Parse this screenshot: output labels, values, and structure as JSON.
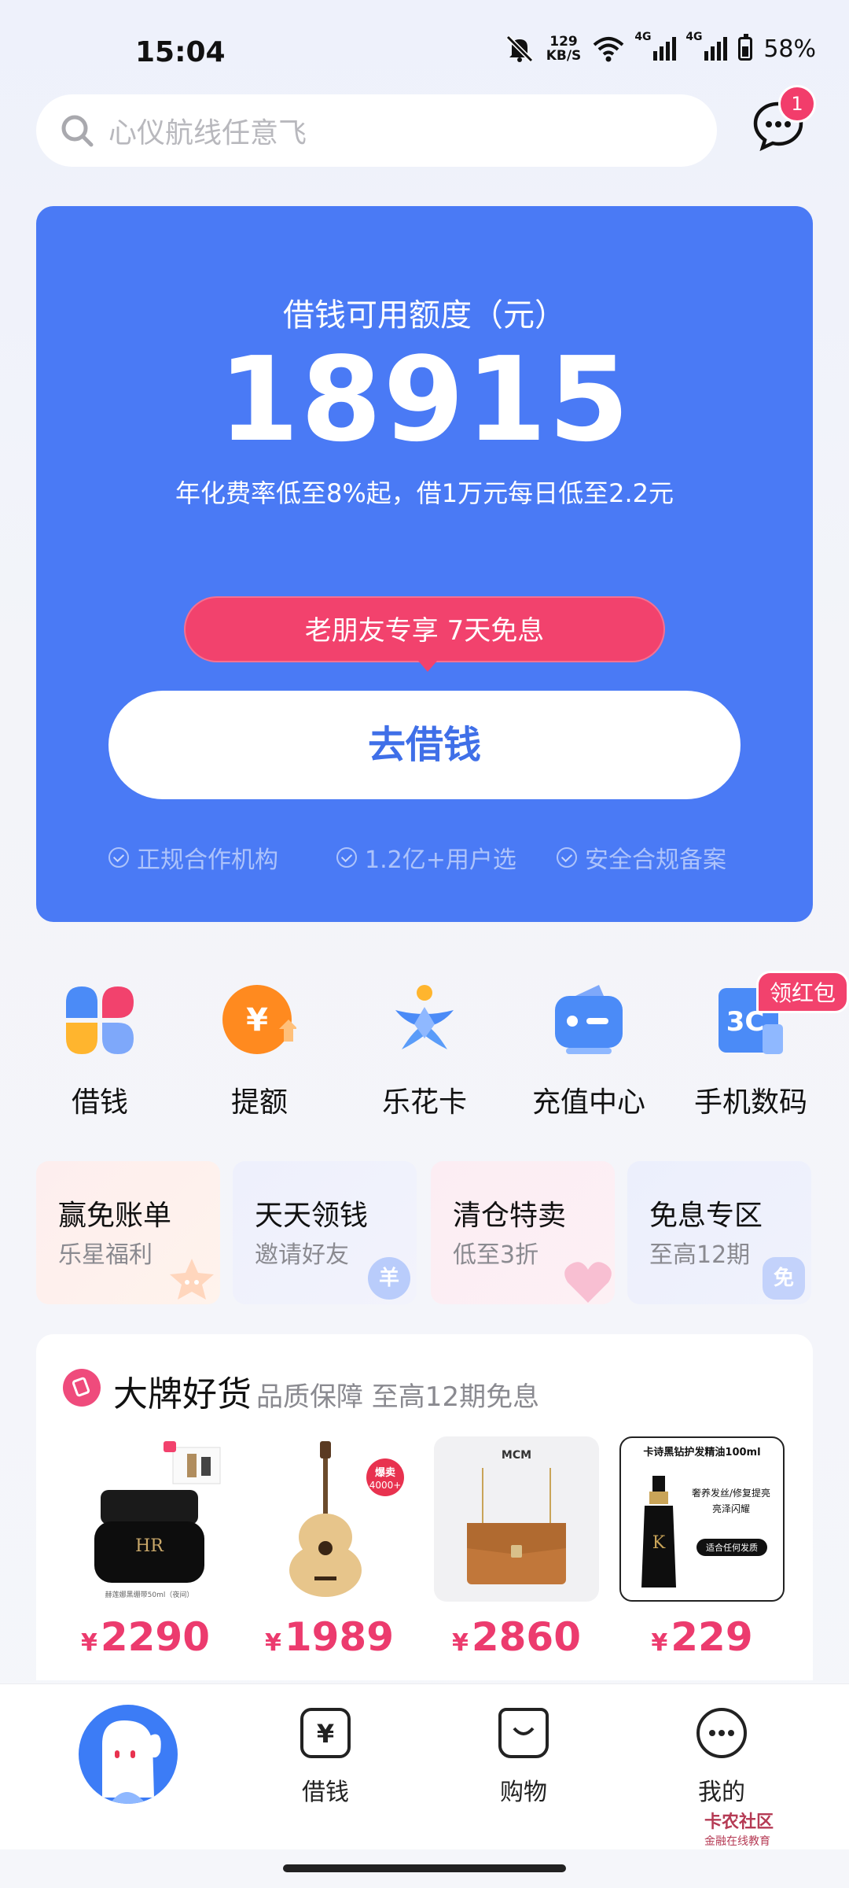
{
  "status_bar": {
    "time": "15:04",
    "net_speed_value": "129",
    "net_speed_unit": "KB/S",
    "signal1": "4G",
    "signal2": "4G",
    "battery": "58%"
  },
  "search": {
    "placeholder": "心仪航线任意飞"
  },
  "message": {
    "badge_count": "1"
  },
  "loan_card": {
    "label": "借钱可用额度（元）",
    "amount": "18915",
    "rate_text": "年化费率低至8%起，借1万元每日低至2.2元",
    "promo_tag": "老朋友专享 7天免息",
    "borrow_button": "去借钱",
    "assurances": [
      "正规合作机构",
      "1.2亿+用户选",
      "安全合规备案"
    ]
  },
  "quick_entries": [
    {
      "label": "借钱",
      "icon": "flower-grid-icon"
    },
    {
      "label": "提额",
      "icon": "yuan-up-icon"
    },
    {
      "label": "乐花卡",
      "icon": "lehua-card-icon"
    },
    {
      "label": "充值中心",
      "icon": "recharge-icon"
    },
    {
      "label": "手机数码",
      "icon": "phone-3c-icon"
    }
  ],
  "red_packet_tag": "领红包",
  "promo_cards": [
    {
      "title": "赢免账单",
      "subtitle": "乐星福利",
      "deco": ""
    },
    {
      "title": "天天领钱",
      "subtitle": "邀请好友",
      "deco": "羊"
    },
    {
      "title": "清仓特卖",
      "subtitle": "低至3折",
      "deco": ""
    },
    {
      "title": "免息专区",
      "subtitle": "至高12期",
      "deco": "免"
    }
  ],
  "brand_section": {
    "title": "大牌好货",
    "subtitle": "品质保障 至高12期免息",
    "products": [
      {
        "currency": "¥",
        "price": "2290",
        "caption": "赫莲娜黑绷带50ml（夜间）"
      },
      {
        "currency": "¥",
        "price": "1989",
        "tag": "爆卖4000+"
      },
      {
        "currency": "¥",
        "price": "2860",
        "brand_mark": "MCM"
      },
      {
        "currency": "¥",
        "price": "229",
        "caption": "卡诗黑钻护发精油100ml",
        "lines": [
          "奢养发丝/修复提亮",
          "亮泽闪耀",
          "适合任何发质"
        ]
      }
    ]
  },
  "tab_bar": {
    "tabs": [
      "借钱",
      "购物",
      "我的"
    ]
  },
  "watermark": {
    "line1": "卡农社区",
    "line2": "金融在线教育"
  },
  "colors": {
    "primary_blue": "#4a7af5",
    "accent_pink": "#f2426d",
    "price_pink": "#ec3b6e"
  }
}
